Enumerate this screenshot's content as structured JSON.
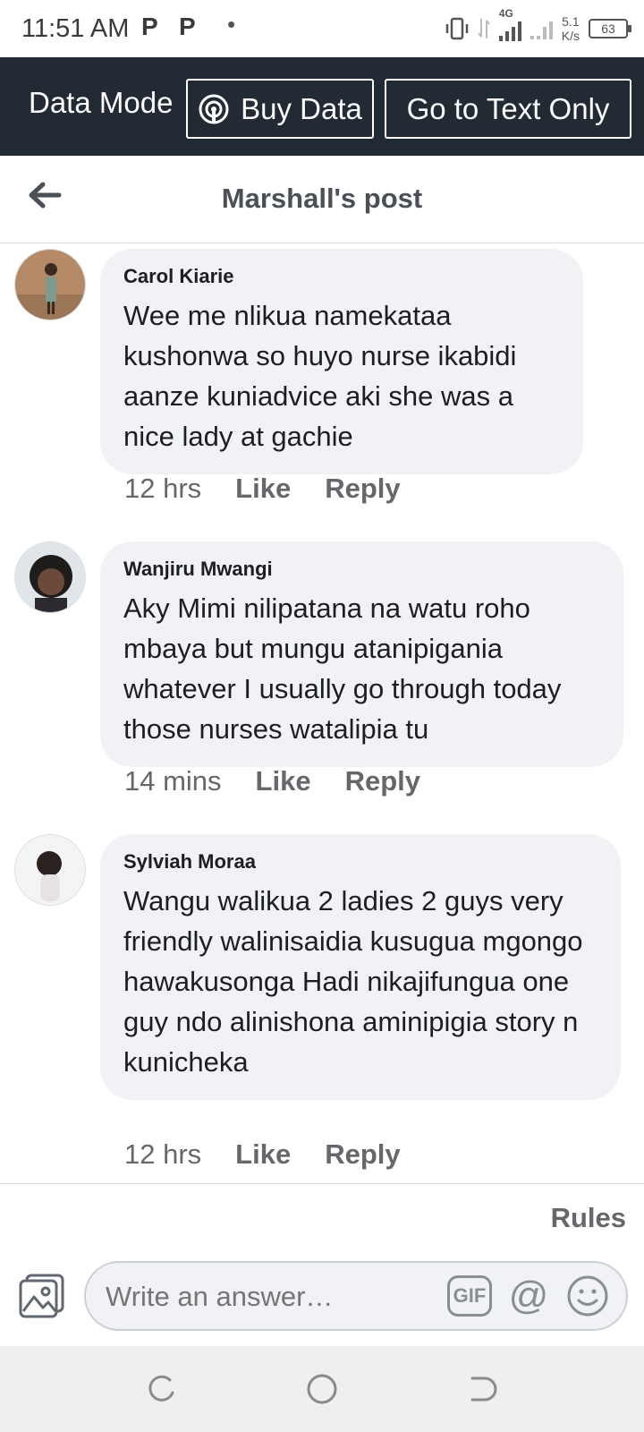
{
  "status_bar": {
    "time": "11:51 AM",
    "notifications": [
      "P",
      "P"
    ],
    "network": "4G",
    "speed_value": "5.1",
    "speed_unit": "K/s",
    "battery": "63"
  },
  "data_bar": {
    "label": "Data Mode",
    "buy_data": "Buy Data",
    "text_only": "Go to Text Only"
  },
  "header": {
    "title": "Marshall's post"
  },
  "comments": [
    {
      "author": "Carol Kiarie",
      "text": "Wee me nlikua namekataa kushonwa  so huyo nurse ikabidi aanze kuniadvice aki she was a nice lady at gachie",
      "time": "12 hrs",
      "like": "Like",
      "reply": "Reply"
    },
    {
      "author": "Wanjiru Mwangi",
      "text": "Aky Mimi nilipatana na watu roho mbaya but mungu atanipigania whatever I usually go through today those nurses watalipia tu",
      "time": "14 mins",
      "like": "Like",
      "reply": "Reply"
    },
    {
      "author": "Sylviah Moraa",
      "text": "Wangu walikua 2 ladies 2 guys very friendly walinisaidia  kusugua mgongo hawakusonga Hadi nikajifungua one guy  ndo alinishona aminipigia story n kunicheka",
      "time": "12 hrs",
      "like": "Like",
      "reply": "Reply"
    }
  ],
  "composer": {
    "rules": "Rules",
    "placeholder": "Write an answer…",
    "gif": "GIF",
    "at": "@"
  },
  "colors": {
    "data_bar_bg": "#222a33",
    "bubble_bg": "#f0f2f5",
    "secondary_text": "#65676b"
  }
}
